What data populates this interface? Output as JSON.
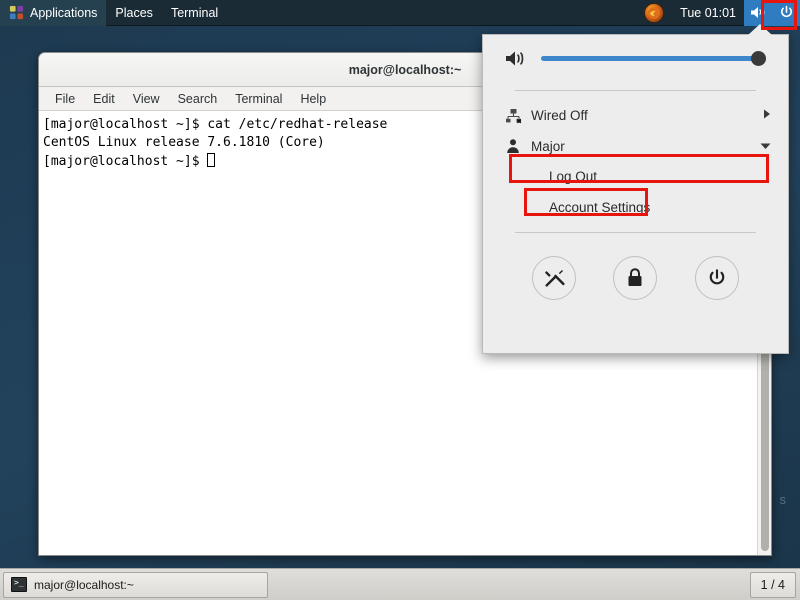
{
  "top_panel": {
    "applications_label": "Applications",
    "places_label": "Places",
    "terminal_label": "Terminal",
    "app_icon": "applications-icon",
    "user_tray_icon": "user-avatar-icon",
    "clock": "Tue 01:01",
    "volume_icon": "speaker-icon",
    "power_icon": "power-icon"
  },
  "desktop": {
    "watermark": "s",
    "background_color": "#1d3a51"
  },
  "terminal": {
    "title": "major@localhost:~",
    "menus": [
      "File",
      "Edit",
      "View",
      "Search",
      "Terminal",
      "Help"
    ],
    "lines": [
      "[major@localhost ~]$ cat /etc/redhat-release",
      "CentOS Linux release 7.6.1810 (Core)"
    ],
    "prompt": "[major@localhost ~]$ ",
    "scrollbar": "vertical-scrollbar"
  },
  "system_menu": {
    "volume": {
      "icon": "speaker-icon",
      "level": 100
    },
    "network": {
      "icon": "wired-network-disconnected-icon",
      "label": "Wired Off",
      "chevron": "chevron-right-icon"
    },
    "user": {
      "icon": "user-icon",
      "label": "Major",
      "chevron": "chevron-down-icon",
      "expanded": true,
      "items": [
        "Log Out",
        "Account Settings"
      ]
    },
    "actions": [
      {
        "name": "settings-button",
        "icon": "tools-icon"
      },
      {
        "name": "lock-button",
        "icon": "lock-icon"
      },
      {
        "name": "power-button",
        "icon": "power-icon"
      }
    ]
  },
  "bottom_panel": {
    "task_label": "major@localhost:~",
    "task_icon": "terminal-icon",
    "workspace": "1 / 4"
  },
  "annotations": {
    "highlight_color": "#e8150f",
    "boxes": [
      "power-tray-icon",
      "user-row-major",
      "log-out-item"
    ]
  }
}
